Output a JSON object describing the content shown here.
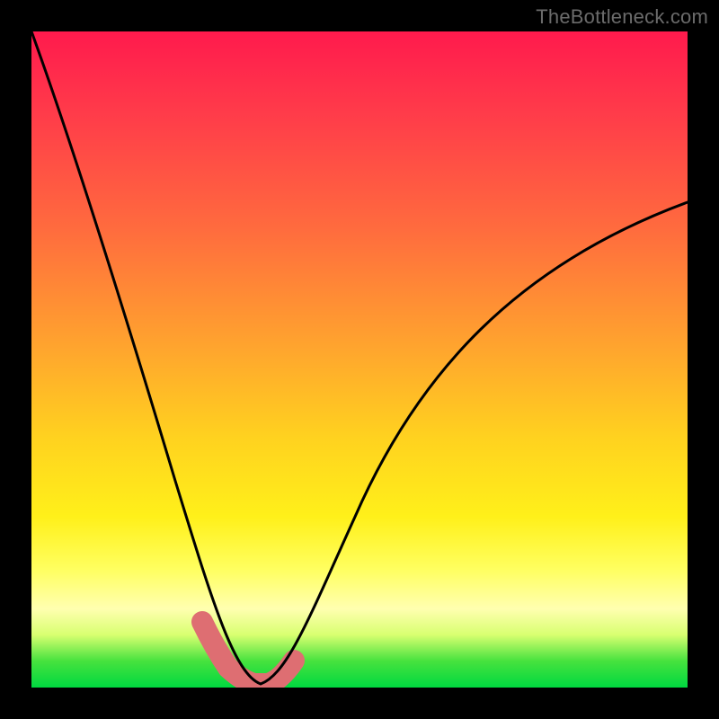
{
  "watermark": "TheBottleneck.com",
  "chart_data": {
    "type": "line",
    "title": "",
    "xlabel": "",
    "ylabel": "",
    "xlim": [
      0,
      100
    ],
    "ylim": [
      0,
      100
    ],
    "series": [
      {
        "name": "bottleneck-curve",
        "x": [
          0,
          4,
          8,
          12,
          16,
          20,
          24,
          26,
          28,
          30,
          32,
          34,
          36,
          38,
          40,
          44,
          50,
          56,
          62,
          68,
          74,
          80,
          86,
          92,
          100
        ],
        "values": [
          100,
          88,
          76,
          64,
          52,
          40,
          28,
          22,
          14,
          7,
          3,
          1,
          1,
          1,
          2,
          6,
          14,
          24,
          34,
          43,
          51,
          58,
          64,
          69,
          74
        ]
      },
      {
        "name": "highlight-band",
        "x": [
          26,
          28,
          30,
          32,
          34,
          36,
          38,
          40
        ],
        "values": [
          10,
          6,
          3,
          1,
          1,
          1,
          3,
          6
        ]
      }
    ],
    "colors": {
      "curve": "#000000",
      "highlight": "#de6e72",
      "gradient_top": "#ff1a4d",
      "gradient_bottom": "#00d840"
    }
  }
}
